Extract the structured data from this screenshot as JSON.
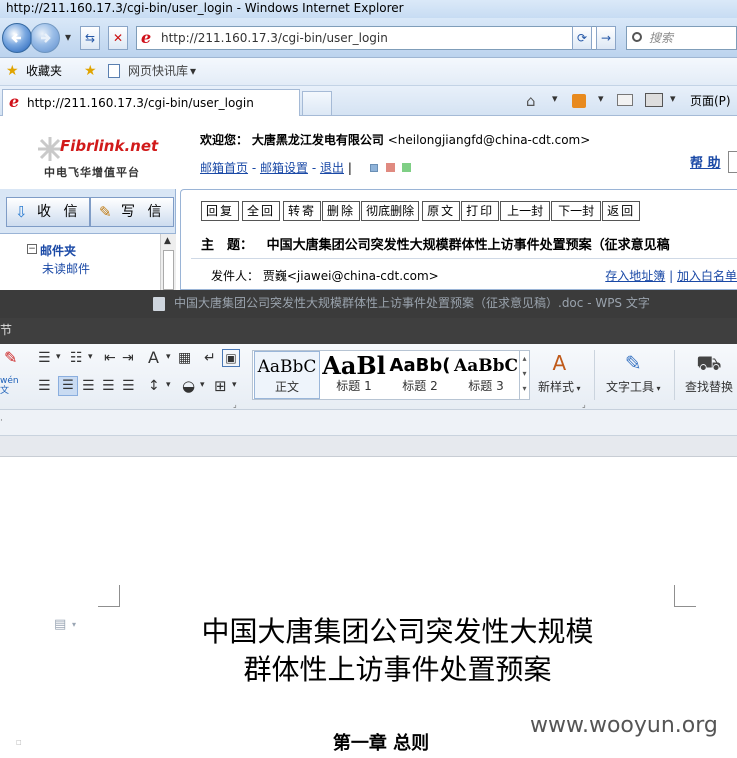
{
  "ie": {
    "title": "http://211.160.17.3/cgi-bin/user_login - Windows Internet Explorer",
    "address": "http://211.160.17.3/cgi-bin/user_login",
    "search_placeholder": "搜索",
    "favorites_label": "收藏夹",
    "web_slice_label": "网页快讯库",
    "tab_label": "http://211.160.17.3/cgi-bin/user_login",
    "page_menu": "页面(P)"
  },
  "mail": {
    "logo_text": "Fibrlink.net",
    "logo_sub": "中电飞华增值平台",
    "welcome_prefix": "欢迎您：",
    "company": "大唐黑龙江发电有限公司",
    "email": "<heilongjiangfd@china-cdt.com>",
    "links": [
      "邮箱首页",
      "邮箱设置",
      "退出"
    ],
    "help": "帮 助",
    "receive": "收 信",
    "write": "写 信",
    "folder": "邮件夹",
    "folder_sub": "未读邮件",
    "actions": [
      "回复",
      "全回",
      "转寄",
      "删除",
      "彻底删除",
      "原文",
      "打印",
      "上一封",
      "下一封",
      "返回"
    ],
    "subject_label": "主　题：",
    "subject": "中国大唐集团公司突发性大规模群体性上访事件处置预案（征求意见稿",
    "from_label": "发件人：",
    "from": "贾巍<jiawei@china-cdt.com>",
    "save_address": "存入地址簿",
    "whitelist": "加入白名单"
  },
  "wps": {
    "title": "中国大唐集团公司突发性大规模群体性上访事件处置预案（征求意见稿）.doc - WPS 文字",
    "menu_fragment": "节",
    "styles": [
      {
        "preview": "AaBbC",
        "name": "正文"
      },
      {
        "preview": "AaBl",
        "name": "标题 1"
      },
      {
        "preview": "AaBb(",
        "name": "标题 2"
      },
      {
        "preview": "AaBbC",
        "name": "标题 3"
      }
    ],
    "new_style": "新样式",
    "text_tools": "文字工具",
    "find_replace": "查找替换",
    "pinyin_fragment": "wén\n文"
  },
  "document": {
    "title_line1": "中国大唐集团公司突发性大规模",
    "title_line2": "群体性上访事件处置预案",
    "chapter": "第一章 总则"
  },
  "watermark": "www.wooyun.org"
}
